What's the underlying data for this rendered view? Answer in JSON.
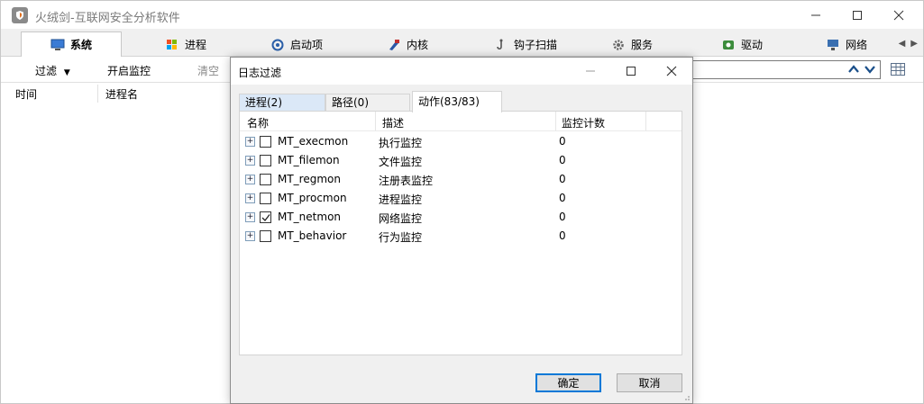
{
  "window": {
    "title": "火绒剑-互联网安全分析软件",
    "app_icon": "shield-icon"
  },
  "main_tabs": [
    {
      "label": "系统",
      "icon": "system-icon",
      "active": true
    },
    {
      "label": "进程",
      "icon": "windows-flag-icon",
      "active": false
    },
    {
      "label": "启动项",
      "icon": "startup-icon",
      "active": false
    },
    {
      "label": "内核",
      "icon": "kernel-icon",
      "active": false
    },
    {
      "label": "钩子扫描",
      "icon": "hook-icon",
      "active": false
    },
    {
      "label": "服务",
      "icon": "gear-icon",
      "active": false
    },
    {
      "label": "驱动",
      "icon": "driver-icon",
      "active": false
    },
    {
      "label": "网络",
      "icon": "network-icon",
      "active": false
    }
  ],
  "toolbar": {
    "filter_label": "过滤",
    "start_monitor_label": "开启监控",
    "clear_label": "清空"
  },
  "columns": {
    "time": "时间",
    "process_name": "进程名"
  },
  "dialog": {
    "title": "日志过滤",
    "tabs": [
      {
        "label": "进程(2)",
        "active": false
      },
      {
        "label": "路径(0)",
        "active": false
      },
      {
        "label": "动作(83/83)",
        "active": true
      }
    ],
    "list_headers": {
      "name": "名称",
      "description": "描述",
      "count": "监控计数"
    },
    "rows": [
      {
        "name": "MT_execmon",
        "description": "执行监控",
        "count": "0",
        "checked": false
      },
      {
        "name": "MT_filemon",
        "description": "文件监控",
        "count": "0",
        "checked": false
      },
      {
        "name": "MT_regmon",
        "description": "注册表监控",
        "count": "0",
        "checked": false
      },
      {
        "name": "MT_procmon",
        "description": "进程监控",
        "count": "0",
        "checked": false
      },
      {
        "name": "MT_netmon",
        "description": "网络监控",
        "count": "0",
        "checked": true
      },
      {
        "name": "MT_behavior",
        "description": "行为监控",
        "count": "0",
        "checked": false
      }
    ],
    "ok_label": "确定",
    "cancel_label": "取消"
  },
  "colors": {
    "accent": "#0078d7",
    "tab_bg": "#f0f0f0",
    "disabled_text": "#8a8a8a",
    "nav_arrow": "#1a4f8a"
  }
}
